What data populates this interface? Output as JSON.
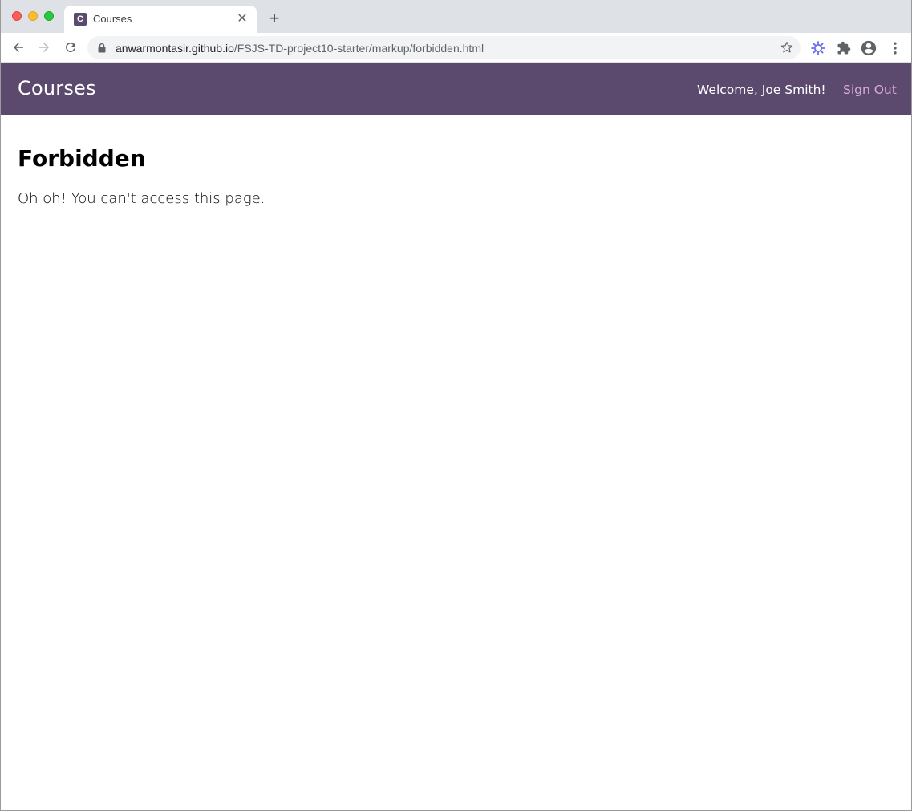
{
  "browser": {
    "tab": {
      "title": "Courses",
      "favicon_letter": "C"
    },
    "address": {
      "host": "anwarmontasir.github.io",
      "path": "/FSJS-TD-project10-starter/markup/forbidden.html"
    },
    "icons": {
      "back": "arrow-left-icon",
      "forward": "arrow-right-icon",
      "reload": "reload-icon",
      "lock": "lock-icon",
      "bookmark": "star-icon",
      "extension_a": "gear-extension-icon",
      "extensions": "puzzle-icon",
      "profile": "account-circle-icon",
      "menu": "more-vert-icon"
    }
  },
  "header": {
    "brand": "Courses",
    "welcome": "Welcome, Joe Smith!",
    "signout": "Sign Out"
  },
  "main": {
    "title": "Forbidden",
    "message": "Oh oh! You can't access this page."
  },
  "colors": {
    "header_bg": "#5b4a6e",
    "signout_link": "#d8a9d6"
  }
}
